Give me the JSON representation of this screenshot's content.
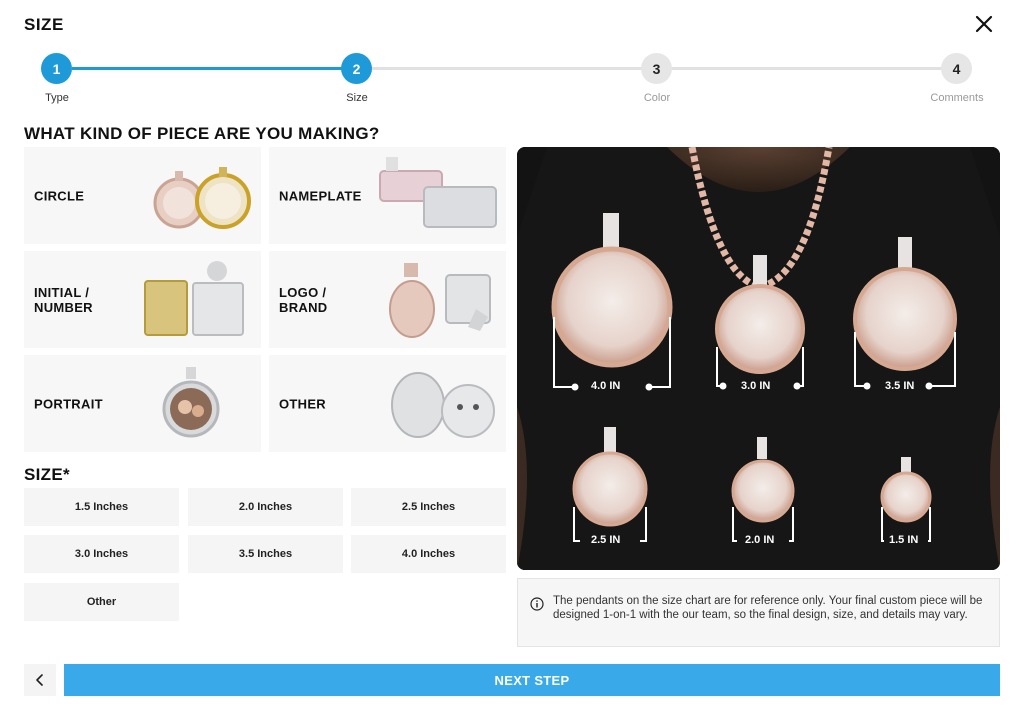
{
  "header": {
    "title": "SIZE",
    "close_icon": "close-icon"
  },
  "stepper": {
    "steps": [
      {
        "number": "1",
        "label": "Type",
        "state": "done"
      },
      {
        "number": "2",
        "label": "Size",
        "state": "current"
      },
      {
        "number": "3",
        "label": "Color",
        "state": "upcoming"
      },
      {
        "number": "4",
        "label": "Comments",
        "state": "upcoming"
      }
    ],
    "accent": "#1f9ad8"
  },
  "piece": {
    "heading": "WHAT KIND OF PIECE ARE YOU MAKING?",
    "options": [
      {
        "label": "CIRCLE"
      },
      {
        "label": "NAMEPLATE"
      },
      {
        "label": "INITIAL / NUMBER"
      },
      {
        "label": "LOGO / BRAND"
      },
      {
        "label": "PORTRAIT"
      },
      {
        "label": "OTHER"
      }
    ]
  },
  "size": {
    "heading": "SIZE*",
    "options": [
      "1.5 Inches",
      "2.0 Inches",
      "2.5 Inches",
      "3.0 Inches",
      "3.5 Inches",
      "4.0 Inches",
      "Other"
    ]
  },
  "chart": {
    "labels": [
      "4.0 IN",
      "3.0 IN",
      "3.5 IN",
      "2.5 IN",
      "2.0 IN",
      "1.5 IN"
    ]
  },
  "note": {
    "icon": "info-icon",
    "text": "The pendants on the size chart are for reference only. Your final custom piece will be designed 1-on-1 with the our team, so the final design, size, and details may vary."
  },
  "footer": {
    "back_icon": "chevron-left-icon",
    "next_label": "NEXT STEP",
    "next_color": "#3aa9ea"
  }
}
